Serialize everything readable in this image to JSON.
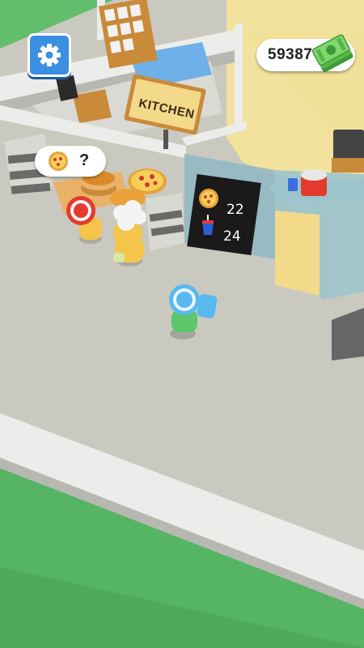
{
  "hud": {
    "money": "59387",
    "settings_icon": "gear-icon",
    "cash_icon": "cash-stack-icon"
  },
  "kitchen_sign": {
    "label": "KITCHEN"
  },
  "order_bubble": {
    "item_icon": "pizza-icon",
    "status": "?"
  },
  "menu_board": {
    "items": [
      {
        "icon": "pizza-icon",
        "count": "22"
      },
      {
        "icon": "soda-cup-icon",
        "count": "24"
      }
    ]
  },
  "colors": {
    "floor": "#c9c9bf",
    "wall": "#ececea",
    "grass": "#56b565",
    "kitchen_floor": "#f2e29e",
    "settings_button": "#3b8ee0"
  }
}
